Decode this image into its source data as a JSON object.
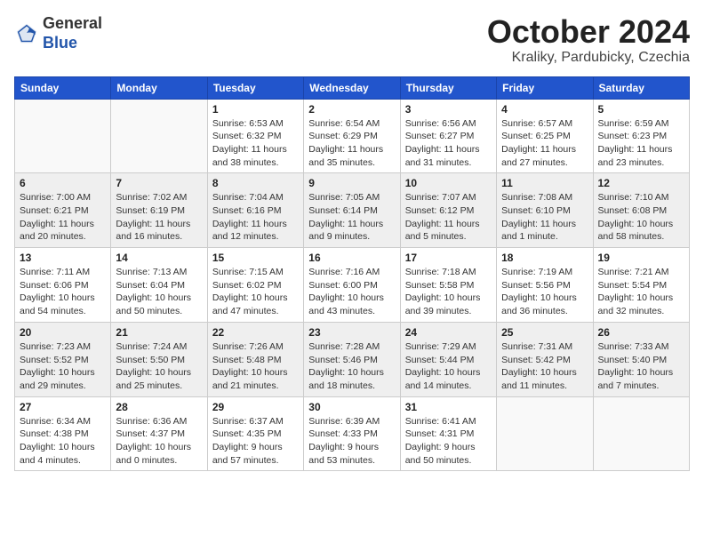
{
  "header": {
    "logo_general": "General",
    "logo_blue": "Blue",
    "month_title": "October 2024",
    "location": "Kraliky, Pardubicky, Czechia"
  },
  "calendar": {
    "days_of_week": [
      "Sunday",
      "Monday",
      "Tuesday",
      "Wednesday",
      "Thursday",
      "Friday",
      "Saturday"
    ],
    "weeks": [
      [
        {
          "day": "",
          "info": ""
        },
        {
          "day": "",
          "info": ""
        },
        {
          "day": "1",
          "info": "Sunrise: 6:53 AM\nSunset: 6:32 PM\nDaylight: 11 hours and 38 minutes."
        },
        {
          "day": "2",
          "info": "Sunrise: 6:54 AM\nSunset: 6:29 PM\nDaylight: 11 hours and 35 minutes."
        },
        {
          "day": "3",
          "info": "Sunrise: 6:56 AM\nSunset: 6:27 PM\nDaylight: 11 hours and 31 minutes."
        },
        {
          "day": "4",
          "info": "Sunrise: 6:57 AM\nSunset: 6:25 PM\nDaylight: 11 hours and 27 minutes."
        },
        {
          "day": "5",
          "info": "Sunrise: 6:59 AM\nSunset: 6:23 PM\nDaylight: 11 hours and 23 minutes."
        }
      ],
      [
        {
          "day": "6",
          "info": "Sunrise: 7:00 AM\nSunset: 6:21 PM\nDaylight: 11 hours and 20 minutes."
        },
        {
          "day": "7",
          "info": "Sunrise: 7:02 AM\nSunset: 6:19 PM\nDaylight: 11 hours and 16 minutes."
        },
        {
          "day": "8",
          "info": "Sunrise: 7:04 AM\nSunset: 6:16 PM\nDaylight: 11 hours and 12 minutes."
        },
        {
          "day": "9",
          "info": "Sunrise: 7:05 AM\nSunset: 6:14 PM\nDaylight: 11 hours and 9 minutes."
        },
        {
          "day": "10",
          "info": "Sunrise: 7:07 AM\nSunset: 6:12 PM\nDaylight: 11 hours and 5 minutes."
        },
        {
          "day": "11",
          "info": "Sunrise: 7:08 AM\nSunset: 6:10 PM\nDaylight: 11 hours and 1 minute."
        },
        {
          "day": "12",
          "info": "Sunrise: 7:10 AM\nSunset: 6:08 PM\nDaylight: 10 hours and 58 minutes."
        }
      ],
      [
        {
          "day": "13",
          "info": "Sunrise: 7:11 AM\nSunset: 6:06 PM\nDaylight: 10 hours and 54 minutes."
        },
        {
          "day": "14",
          "info": "Sunrise: 7:13 AM\nSunset: 6:04 PM\nDaylight: 10 hours and 50 minutes."
        },
        {
          "day": "15",
          "info": "Sunrise: 7:15 AM\nSunset: 6:02 PM\nDaylight: 10 hours and 47 minutes."
        },
        {
          "day": "16",
          "info": "Sunrise: 7:16 AM\nSunset: 6:00 PM\nDaylight: 10 hours and 43 minutes."
        },
        {
          "day": "17",
          "info": "Sunrise: 7:18 AM\nSunset: 5:58 PM\nDaylight: 10 hours and 39 minutes."
        },
        {
          "day": "18",
          "info": "Sunrise: 7:19 AM\nSunset: 5:56 PM\nDaylight: 10 hours and 36 minutes."
        },
        {
          "day": "19",
          "info": "Sunrise: 7:21 AM\nSunset: 5:54 PM\nDaylight: 10 hours and 32 minutes."
        }
      ],
      [
        {
          "day": "20",
          "info": "Sunrise: 7:23 AM\nSunset: 5:52 PM\nDaylight: 10 hours and 29 minutes."
        },
        {
          "day": "21",
          "info": "Sunrise: 7:24 AM\nSunset: 5:50 PM\nDaylight: 10 hours and 25 minutes."
        },
        {
          "day": "22",
          "info": "Sunrise: 7:26 AM\nSunset: 5:48 PM\nDaylight: 10 hours and 21 minutes."
        },
        {
          "day": "23",
          "info": "Sunrise: 7:28 AM\nSunset: 5:46 PM\nDaylight: 10 hours and 18 minutes."
        },
        {
          "day": "24",
          "info": "Sunrise: 7:29 AM\nSunset: 5:44 PM\nDaylight: 10 hours and 14 minutes."
        },
        {
          "day": "25",
          "info": "Sunrise: 7:31 AM\nSunset: 5:42 PM\nDaylight: 10 hours and 11 minutes."
        },
        {
          "day": "26",
          "info": "Sunrise: 7:33 AM\nSunset: 5:40 PM\nDaylight: 10 hours and 7 minutes."
        }
      ],
      [
        {
          "day": "27",
          "info": "Sunrise: 6:34 AM\nSunset: 4:38 PM\nDaylight: 10 hours and 4 minutes."
        },
        {
          "day": "28",
          "info": "Sunrise: 6:36 AM\nSunset: 4:37 PM\nDaylight: 10 hours and 0 minutes."
        },
        {
          "day": "29",
          "info": "Sunrise: 6:37 AM\nSunset: 4:35 PM\nDaylight: 9 hours and 57 minutes."
        },
        {
          "day": "30",
          "info": "Sunrise: 6:39 AM\nSunset: 4:33 PM\nDaylight: 9 hours and 53 minutes."
        },
        {
          "day": "31",
          "info": "Sunrise: 6:41 AM\nSunset: 4:31 PM\nDaylight: 9 hours and 50 minutes."
        },
        {
          "day": "",
          "info": ""
        },
        {
          "day": "",
          "info": ""
        }
      ]
    ]
  }
}
